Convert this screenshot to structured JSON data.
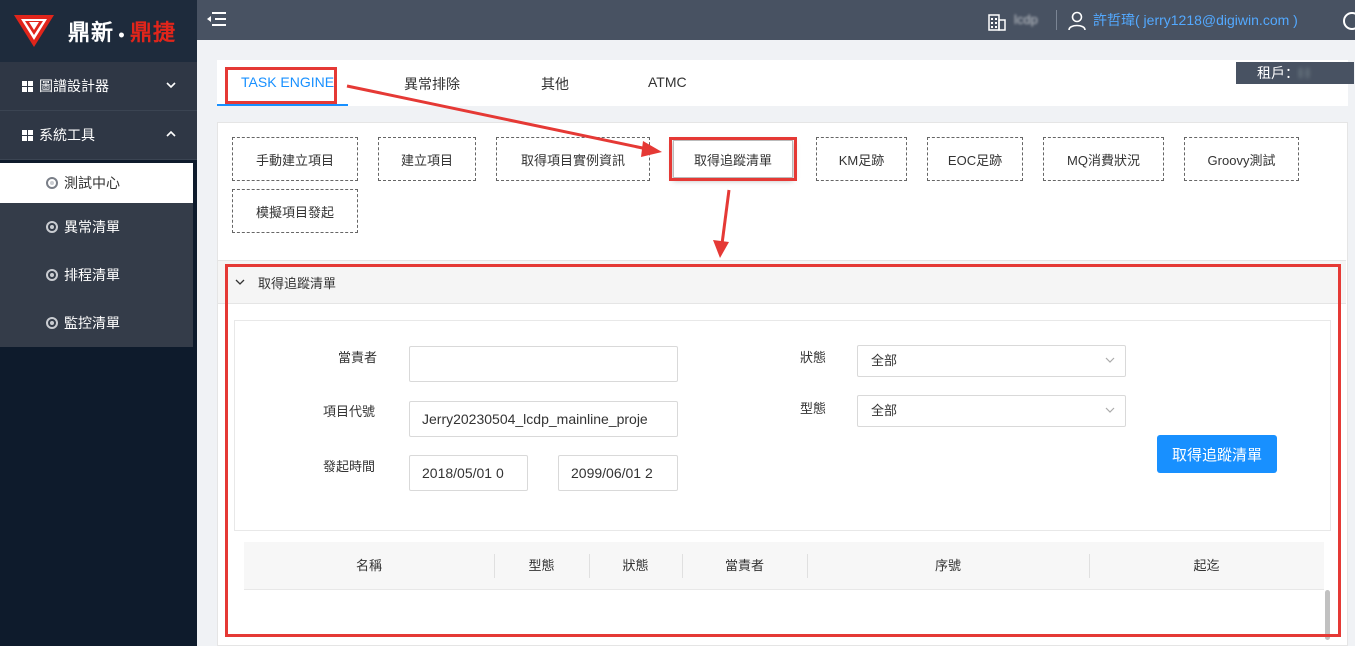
{
  "logo": {
    "text_part1": "鼎新",
    "dot": "•",
    "text_part2": "鼎捷",
    "brand_red": "#e1251b"
  },
  "sidebar": {
    "groups": [
      {
        "label": "圖譜設計器",
        "expanded": false
      },
      {
        "label": "系統工具",
        "expanded": true
      }
    ],
    "items": [
      {
        "label": "測試中心",
        "active": true
      },
      {
        "label": "異常清單",
        "active": false
      },
      {
        "label": "排程清單",
        "active": false
      },
      {
        "label": "監控清單",
        "active": false
      }
    ]
  },
  "header": {
    "tenant_short": "lcdp",
    "user": "許哲瑋( jerry1218@digiwin.com )"
  },
  "tabs": [
    {
      "label": "TASK ENGINE",
      "active": true
    },
    {
      "label": "異常排除",
      "active": false
    },
    {
      "label": "其他",
      "active": false
    },
    {
      "label": "ATMC",
      "active": false
    }
  ],
  "tenant_badge": {
    "label": "租戶：",
    "value": "l  l"
  },
  "tools": [
    "手動建立項目",
    "建立項目",
    "取得項目實例資訊",
    "取得追蹤清單",
    "KM足跡",
    "EOC足跡",
    "MQ消費狀況",
    "Groovy測試",
    "模擬項目發起"
  ],
  "section": {
    "title": "取得追蹤清單",
    "form": {
      "owner_label": "當責者",
      "owner_value": "",
      "project_code_label": "項目代號",
      "project_code_value": "Jerry20230504_lcdp_mainline_proje",
      "start_time_label": "發起時間",
      "start_from": "2018/05/01 0",
      "start_to": "2099/06/01 2",
      "status_label": "狀態",
      "status_value": "全部",
      "type_label": "型態",
      "type_value": "全部",
      "submit_label": "取得追蹤清單"
    },
    "table_columns": [
      "名稱",
      "型態",
      "狀態",
      "當責者",
      "序號",
      "起迄"
    ]
  },
  "colors": {
    "accent": "#1890ff",
    "annotation": "#e53935",
    "sidebar_bg": "#0e1b2c",
    "header_bg": "#485262"
  }
}
